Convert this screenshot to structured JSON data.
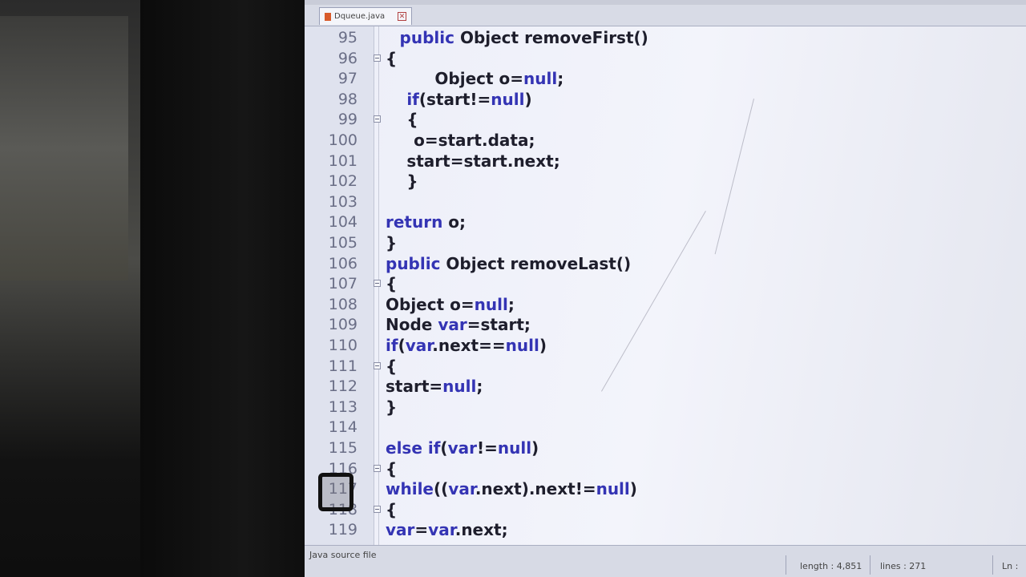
{
  "tab": {
    "label": "Dqueue.java",
    "close": "✕"
  },
  "code_lines": [
    {
      "n": "95",
      "indent": 2,
      "parts": [
        [
          "public",
          "kw"
        ],
        [
          " Object removeFirst()",
          ""
        ]
      ],
      "fold": false
    },
    {
      "n": "96",
      "indent": 0,
      "parts": [
        [
          "{",
          ""
        ]
      ],
      "fold": true
    },
    {
      "n": "97",
      "indent": 7,
      "parts": [
        [
          "Object o=",
          ""
        ],
        [
          "null",
          "kw"
        ],
        [
          ";",
          ""
        ]
      ],
      "fold": false
    },
    {
      "n": "98",
      "indent": 3,
      "parts": [
        [
          "if",
          "kw"
        ],
        [
          "(start!=",
          ""
        ],
        [
          "null",
          "kw"
        ],
        [
          ")",
          ""
        ]
      ],
      "fold": false
    },
    {
      "n": "99",
      "indent": 3,
      "parts": [
        [
          "{",
          ""
        ]
      ],
      "fold": true
    },
    {
      "n": "100",
      "indent": 4,
      "parts": [
        [
          "o=start.data;",
          ""
        ]
      ],
      "fold": false
    },
    {
      "n": "101",
      "indent": 3,
      "parts": [
        [
          "start=start.next;",
          ""
        ]
      ],
      "fold": false
    },
    {
      "n": "102",
      "indent": 3,
      "parts": [
        [
          "}",
          ""
        ]
      ],
      "fold": false
    },
    {
      "n": "103",
      "indent": 0,
      "parts": [],
      "fold": false
    },
    {
      "n": "104",
      "indent": 0,
      "parts": [
        [
          "return",
          "kw"
        ],
        [
          " o;",
          ""
        ]
      ],
      "fold": false
    },
    {
      "n": "105",
      "indent": 0,
      "parts": [
        [
          "}",
          ""
        ]
      ],
      "fold": false
    },
    {
      "n": "106",
      "indent": 0,
      "parts": [
        [
          "public",
          "kw"
        ],
        [
          " Object removeLast()",
          ""
        ]
      ],
      "fold": false
    },
    {
      "n": "107",
      "indent": 0,
      "parts": [
        [
          "{",
          ""
        ]
      ],
      "fold": true
    },
    {
      "n": "108",
      "indent": 0,
      "parts": [
        [
          "Object o=",
          ""
        ],
        [
          "null",
          "kw"
        ],
        [
          ";",
          ""
        ]
      ],
      "fold": false
    },
    {
      "n": "109",
      "indent": 0,
      "parts": [
        [
          "Node ",
          ""
        ],
        [
          "var",
          "kw"
        ],
        [
          "=start;",
          ""
        ]
      ],
      "fold": false
    },
    {
      "n": "110",
      "indent": 0,
      "parts": [
        [
          "if",
          "kw"
        ],
        [
          "(",
          ""
        ],
        [
          "var",
          "kw"
        ],
        [
          ".next==",
          ""
        ],
        [
          "null",
          "kw"
        ],
        [
          ")",
          ""
        ]
      ],
      "fold": false
    },
    {
      "n": "111",
      "indent": 0,
      "parts": [
        [
          "{",
          ""
        ]
      ],
      "fold": true
    },
    {
      "n": "112",
      "indent": 0,
      "parts": [
        [
          "start=",
          ""
        ],
        [
          "null",
          "kw"
        ],
        [
          ";",
          ""
        ]
      ],
      "fold": false
    },
    {
      "n": "113",
      "indent": 0,
      "parts": [
        [
          "}",
          ""
        ]
      ],
      "fold": false
    },
    {
      "n": "114",
      "indent": 0,
      "parts": [],
      "fold": false
    },
    {
      "n": "115",
      "indent": 0,
      "parts": [
        [
          "else if",
          "kw"
        ],
        [
          "(",
          ""
        ],
        [
          "var",
          "kw"
        ],
        [
          "!=",
          ""
        ],
        [
          "null",
          "kw"
        ],
        [
          ")",
          ""
        ]
      ],
      "fold": false
    },
    {
      "n": "116",
      "indent": 0,
      "parts": [
        [
          "{",
          ""
        ]
      ],
      "fold": true
    },
    {
      "n": "117",
      "indent": 0,
      "parts": [
        [
          "while",
          "kw"
        ],
        [
          "((",
          ""
        ],
        [
          "var",
          "kw"
        ],
        [
          ".next).next!=",
          ""
        ],
        [
          "null",
          "kw"
        ],
        [
          ")",
          ""
        ]
      ],
      "fold": false
    },
    {
      "n": "118",
      "indent": 0,
      "parts": [
        [
          "{",
          ""
        ]
      ],
      "fold": true
    },
    {
      "n": "119",
      "indent": 0,
      "parts": [
        [
          "var",
          "kw"
        ],
        [
          "=",
          ""
        ],
        [
          "var",
          "kw"
        ],
        [
          ".next;",
          ""
        ]
      ],
      "fold": false
    }
  ],
  "status": {
    "file_type": "Java source file",
    "length": "length : 4,851",
    "lines": "lines : 271",
    "position": "Ln :"
  }
}
